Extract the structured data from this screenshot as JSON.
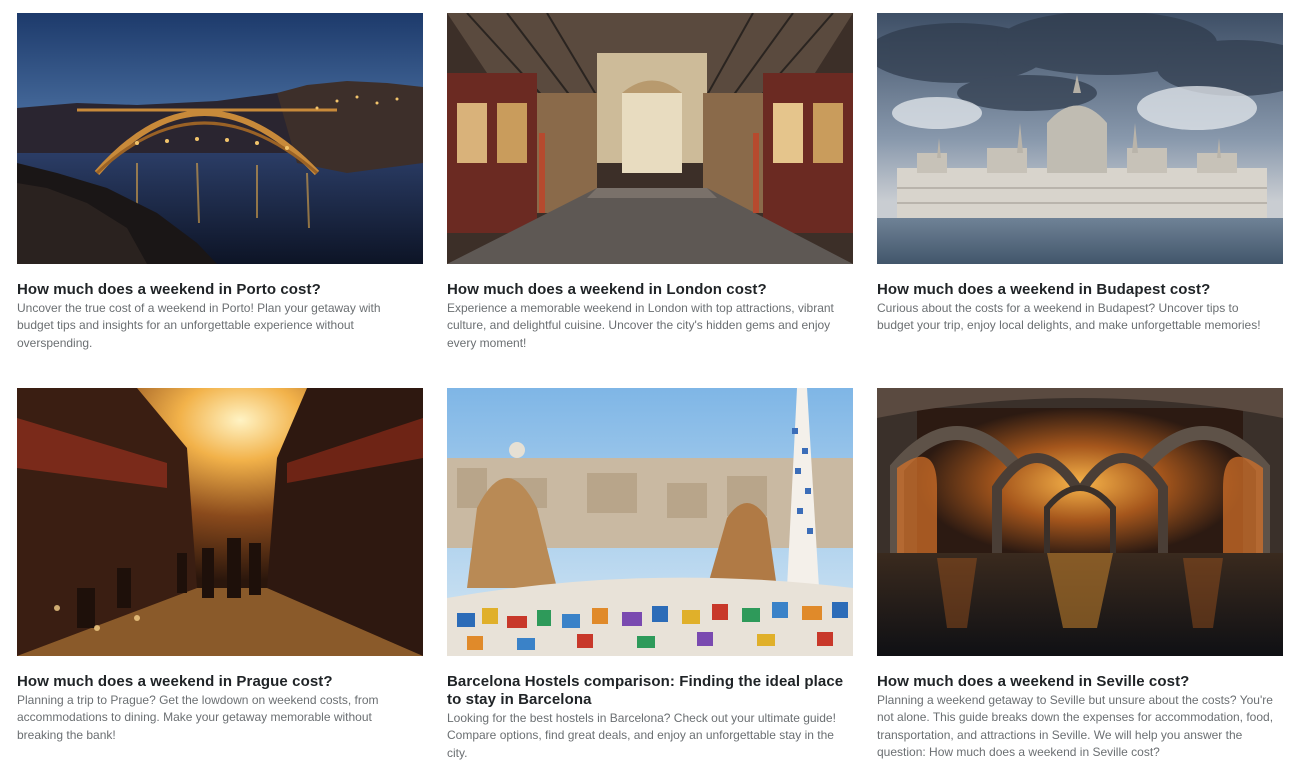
{
  "articles": [
    {
      "image": "porto-bridge-night-photo",
      "title": "How much does a weekend in Porto cost?",
      "description": "Uncover the true cost of a weekend in Porto! Plan your getaway with budget tips and insights for an unforgettable experience without overspending."
    },
    {
      "image": "london-leadenhall-market-photo",
      "title": "How much does a weekend in London cost?",
      "description": "Experience a memorable weekend in London with top attractions, vibrant culture, and delightful cuisine. Uncover the city's hidden gems and enjoy every moment!"
    },
    {
      "image": "budapest-parliament-photo",
      "title": "How much does a weekend in Budapest cost?",
      "description": "Curious about the costs for a weekend in Budapest? Uncover tips to budget your trip, enjoy local delights, and make unforgettable memories!"
    },
    {
      "image": "prague-sunset-street-photo",
      "title": "How much does a weekend in Prague cost?",
      "description": "Planning a trip to Prague? Get the lowdown on weekend costs, from accommodations to dining. Make your getaway memorable without breaking the bank!"
    },
    {
      "image": "barcelona-park-guell-photo",
      "title": "Barcelona Hostels comparison: Finding the ideal place to stay in Barcelona",
      "description": "Looking for the best hostels in Barcelona? Check out your ultimate guide! Compare options, find great deals, and enjoy an unforgettable stay in the city."
    },
    {
      "image": "seville-arches-photo",
      "title": "How much does a weekend in Seville cost?",
      "description": "Planning a weekend getaway to Seville but unsure about the costs? You're not alone. This guide breaks down the expenses for accommodation, food, transportation, and attractions in Seville. We will help you answer the question: How much does a weekend in Seville cost?"
    }
  ]
}
